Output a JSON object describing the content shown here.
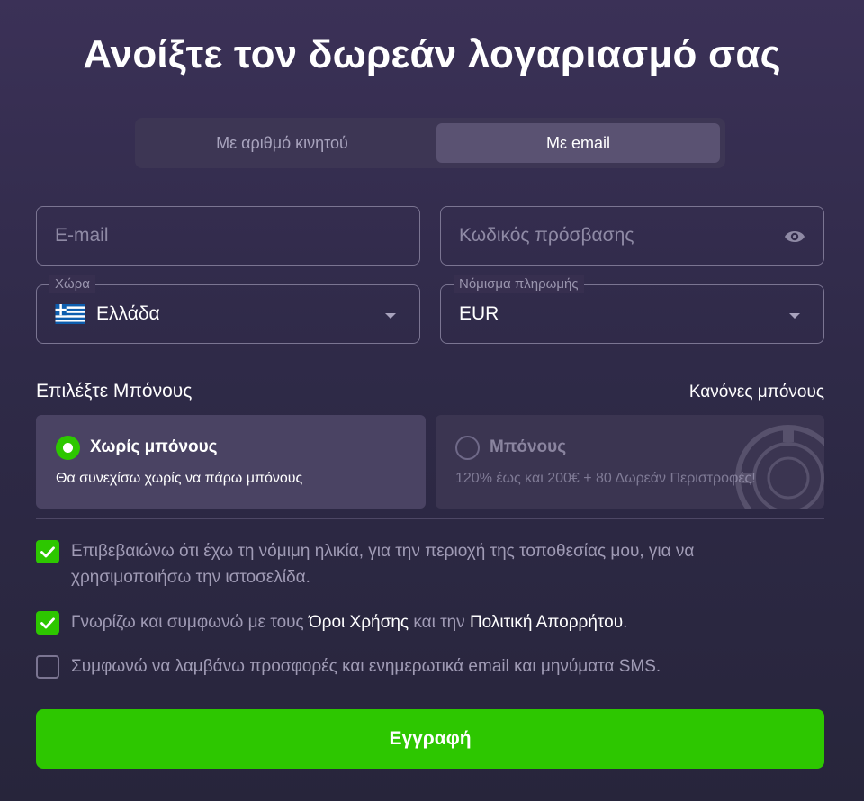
{
  "title": "Ανοίξτε τον δωρεάν λογαριασμό σας",
  "tabs": [
    {
      "label": "Με αριθμό κινητού",
      "active": false
    },
    {
      "label": "Με email",
      "active": true
    }
  ],
  "fields": {
    "email_placeholder": "E-mail",
    "password_placeholder": "Κωδικός πρόσβασης",
    "country_label": "Χώρα",
    "country_value": "Ελλάδα",
    "currency_label": "Νόμισμα πληρωμής",
    "currency_value": "EUR"
  },
  "bonus": {
    "section_label": "Επιλέξτε Μπόνους",
    "rules_link": "Κανόνες μπόνους",
    "options": [
      {
        "title": "Χωρίς μπόνους",
        "desc": "Θα συνεχίσω χωρίς να πάρω μπόνους",
        "selected": true
      },
      {
        "title": "Μπόνους",
        "desc": "120% έως και 200€ + 80 Δωρεάν Περιστροφές!",
        "selected": false
      }
    ]
  },
  "checkboxes": {
    "age": {
      "checked": true,
      "text": "Επιβεβαιώνω ότι έχω τη νόμιμη ηλικία, για την περιοχή της τοποθεσίας μου, για να χρησιμοποιήσω την ιστοσελίδα."
    },
    "terms": {
      "checked": true,
      "pre": "Γνωρίζω και συμφωνώ με τους ",
      "terms_link": "Όροι Χρήσης",
      "mid": " και την ",
      "privacy_link": "Πολιτική Απορρήτου",
      "post": "."
    },
    "marketing": {
      "checked": false,
      "text": "Συμφωνώ να λαμβάνω προσφορές και ενημερωτικά email και μηνύματα SMS."
    }
  },
  "submit_label": "Εγγραφή",
  "colors": {
    "accent": "#2dc700",
    "background": "#2f2a48"
  },
  "icons": {
    "password_toggle": "eye-icon",
    "country_flag": "greece-flag-icon",
    "dropdown": "caret-down-icon",
    "bonus_decor": "casino-chip-icon"
  }
}
